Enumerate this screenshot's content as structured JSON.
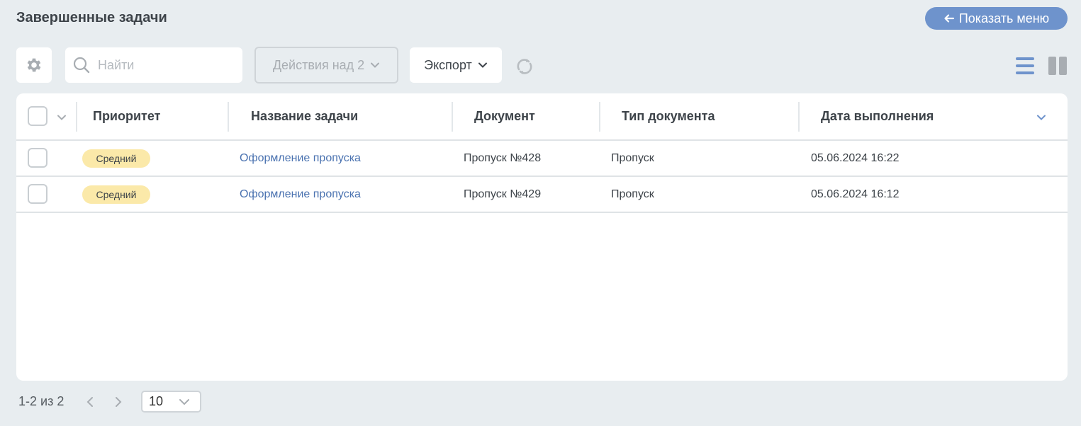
{
  "header": {
    "title": "Завершенные задачи",
    "menu_button": "Показать меню"
  },
  "toolbar": {
    "search_placeholder": "Найти",
    "actions_label": "Действия над 2",
    "export_label": "Экспорт"
  },
  "table": {
    "columns": [
      "Приоритет",
      "Название задачи",
      "Документ",
      "Тип документа",
      "Дата выполнения"
    ],
    "rows": [
      {
        "priority": "Средний",
        "task": "Оформление пропуска",
        "document": "Пропуск №428",
        "doc_type": "Пропуск",
        "date": "05.06.2024 16:22"
      },
      {
        "priority": "Средний",
        "task": "Оформление пропуска",
        "document": "Пропуск №429",
        "doc_type": "Пропуск",
        "date": "05.06.2024 16:12"
      }
    ]
  },
  "pager": {
    "range": "1-2 из 2",
    "page_size": "10"
  },
  "icons": [
    "arrow-left-icon",
    "gear-icon",
    "search-icon",
    "chevron-down-icon",
    "refresh-icon",
    "list-view-icon",
    "column-view-icon",
    "chevron-left-icon",
    "chevron-right-icon"
  ],
  "colors": {
    "accent": "#6e93cc",
    "link": "#4a72b0",
    "badge": "#fbe9a9",
    "background": "#e8edf0"
  }
}
